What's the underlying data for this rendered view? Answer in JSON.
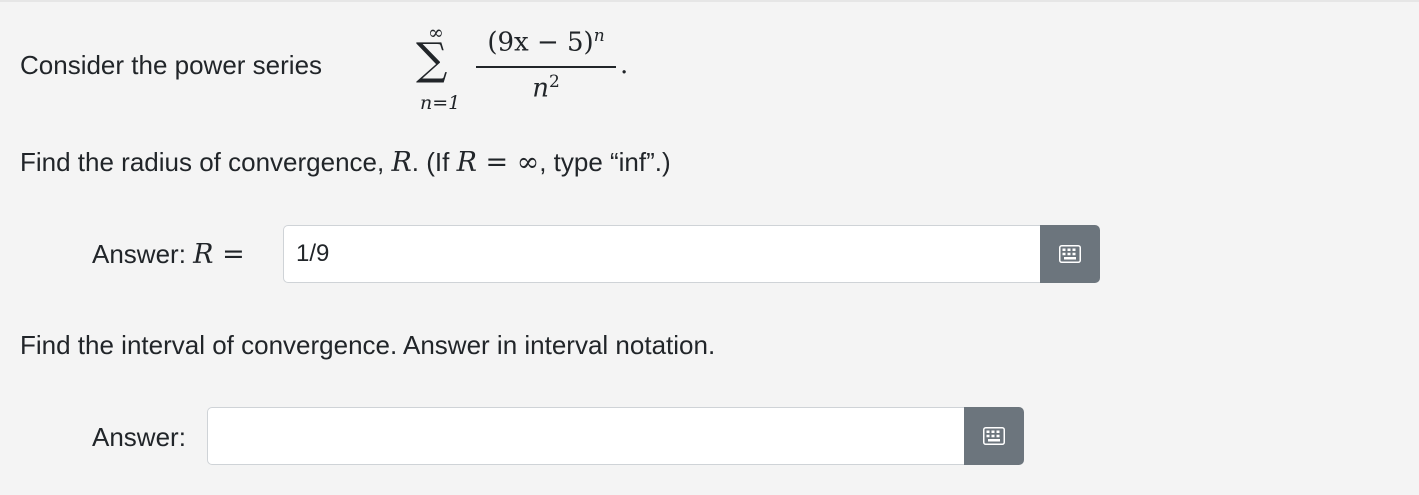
{
  "problem": {
    "intro_text": "Consider the power series",
    "series": {
      "upper_limit": "∞",
      "sum_symbol": "∑",
      "lower_limit": "n=1",
      "numerator_base": "(9x − 5)",
      "numerator_exponent": "n",
      "denominator_base": "n",
      "denominator_exponent": "2",
      "terminal_period": "."
    }
  },
  "question1": {
    "text_before": "Find the radius of convergence, ",
    "var": "R",
    "text_middle": ". (If ",
    "condition": "R = ∞",
    "text_after": ", type “inf”.)",
    "answer_label_text": "Answer: ",
    "answer_label_math": "R =",
    "answer_value": "1/9",
    "keyboard_icon": "keyboard-icon"
  },
  "question2": {
    "text": "Find the interval of convergence. Answer in interval notation.",
    "answer_label": "Answer:",
    "answer_value": "",
    "keyboard_icon": "keyboard-icon"
  },
  "colors": {
    "page_background": "#f4f4f4",
    "text": "#212529",
    "input_border": "#cfd3d7",
    "keyboard_button": "#6c757d"
  }
}
